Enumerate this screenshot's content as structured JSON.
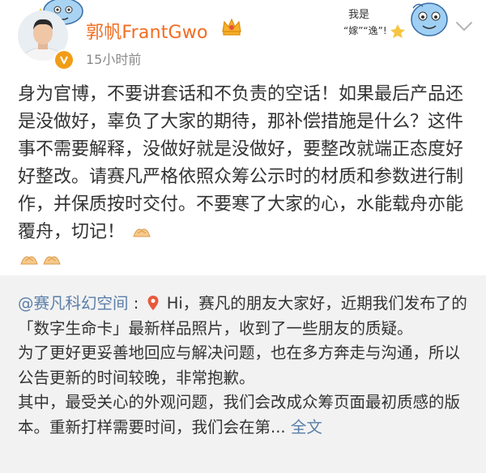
{
  "header": {
    "username": "郭帆FrantGwo",
    "timestamp": "15小时前",
    "sticker_text": "我是“嫁”“逸”!"
  },
  "post": {
    "paragraph": "身为官博，不要讲套话和不负责的空话！如果最后产品还是没做好，辜负了大家的期待，那补偿措施是什么？这件事不需要解释，没做好就是没做好，要整改就端正态度好好整改。请赛凡严格依照众筹公示时的材质和参数进行制作，并保质按时交付。不要寒了大家的心，水能载舟亦能覆舟，切记！",
    "emojis": [
      "clap-hands-icon",
      "clap-hands-icon",
      "clap-hands-icon"
    ]
  },
  "repost": {
    "mention": "@赛凡科幻空间",
    "separator": ":",
    "line1_rest": "Hi，赛凡的朋友大家好，近期我们发布了的「数字生命卡」最新样品照片，收到了一些朋友的质疑。",
    "para2": "为了更好更妥善地回应与解决问题，也在多方奔走与沟通，所以公告更新的时间较晚，非常抱歉。",
    "para3": "其中，最受关心的外观问题，我们会改成众筹页面最初质感的版本。重新打样需要时间，我们会在第...",
    "full_text_link": "全文"
  },
  "colors": {
    "username": "#f26d21",
    "link": "#5b7ea8",
    "repost_bg": "#f2f2f2",
    "timestamp": "#8a8a8a"
  }
}
